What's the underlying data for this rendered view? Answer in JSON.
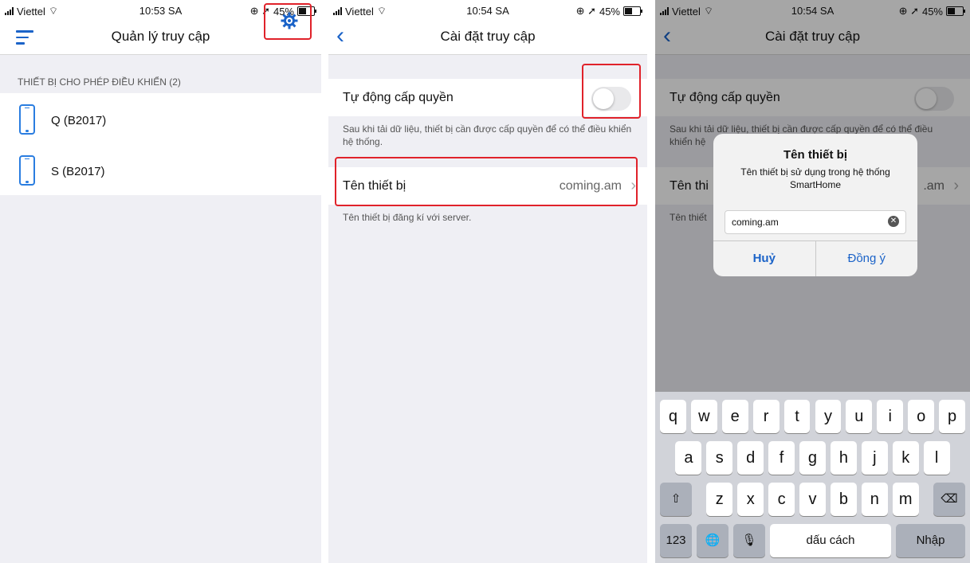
{
  "screens": [
    {
      "status": {
        "carrier": "Viettel",
        "time": "10:53 SA",
        "battery": "45%"
      },
      "title": "Quản lý truy cập",
      "section_header": "THIẾT BỊ CHO PHÉP ĐIỀU KHIỂN (2)",
      "devices": [
        {
          "name": "Q (B2017)"
        },
        {
          "name": "S (B2017)"
        }
      ]
    },
    {
      "status": {
        "carrier": "Viettel",
        "time": "10:54 SA",
        "battery": "45%"
      },
      "title": "Cài đặt truy cập",
      "auto_grant_label": "Tự động cấp quyền",
      "auto_grant_on": false,
      "auto_grant_note": "Sau khi tải dữ liệu, thiết bị cần được cấp quyền để có thể điều khiển hệ thống.",
      "device_name_label": "Tên thiết bị",
      "device_name_value": "coming.am",
      "device_name_note": "Tên thiết bị đăng kí với server."
    },
    {
      "status": {
        "carrier": "Viettel",
        "time": "10:54 SA",
        "battery": "45%"
      },
      "title": "Cài đặt truy cập",
      "auto_grant_label": "Tự động cấp quyền",
      "auto_grant_note_visible": "Sau khi tải dữ liệu, thiết bị cần được cấp quyền để có thể điều",
      "auto_grant_note_partial": "khiển hệ",
      "device_name_label_partial": "Tên thi",
      "device_name_value_partial": ".am",
      "device_name_note_partial": "Tên thiết",
      "dialog": {
        "title": "Tên thiết bị",
        "message": "Tên thiết bị sử dụng trong hệ thống SmartHome",
        "input_value": "coming.am",
        "cancel": "Huỷ",
        "ok": "Đồng ý"
      },
      "keyboard": {
        "row1": [
          "q",
          "w",
          "e",
          "r",
          "t",
          "y",
          "u",
          "i",
          "o",
          "p"
        ],
        "row2": [
          "a",
          "s",
          "d",
          "f",
          "g",
          "h",
          "j",
          "k",
          "l"
        ],
        "row3": [
          "z",
          "x",
          "c",
          "v",
          "b",
          "n",
          "m"
        ],
        "numbers_key": "123",
        "space_key": "dấu cách",
        "return_key": "Nhập"
      }
    }
  ],
  "colors": {
    "accent": "#1b63c8",
    "highlight": "#e0222a"
  }
}
